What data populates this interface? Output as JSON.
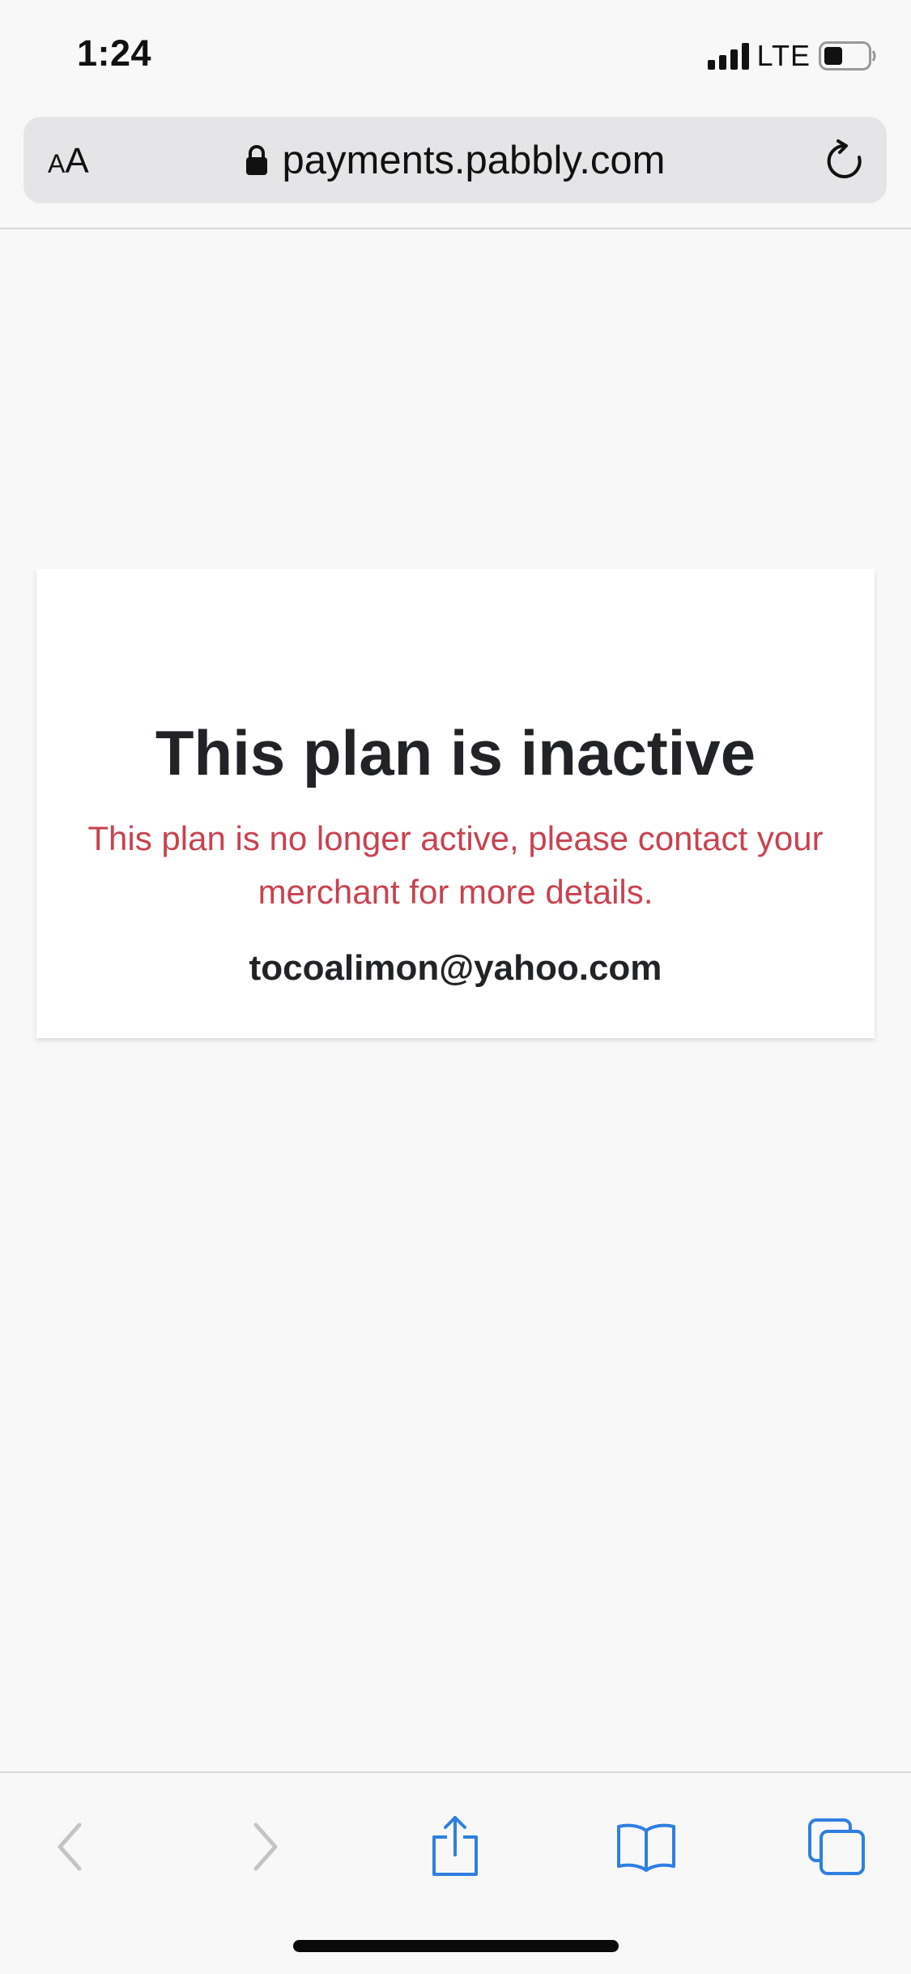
{
  "status_bar": {
    "time": "1:24",
    "network": "LTE",
    "signal_icon": "signal-bars-icon",
    "battery_icon": "battery-icon"
  },
  "browser": {
    "text_size_button": {
      "small": "A",
      "large": "A"
    },
    "lock_icon": "lock-icon",
    "url": "payments.pabbly.com",
    "reload_icon": "reload-icon"
  },
  "card": {
    "title": "This plan is inactive",
    "message": "This plan is no longer active, please contact your merchant for more details.",
    "email": "tocoalimon@yahoo.com"
  },
  "toolbar": {
    "items": [
      {
        "icon": "back-chevron-icon",
        "enabled": false
      },
      {
        "icon": "forward-chevron-icon",
        "enabled": false
      },
      {
        "icon": "share-icon",
        "enabled": true
      },
      {
        "icon": "bookmarks-icon",
        "enabled": true
      },
      {
        "icon": "tabs-icon",
        "enabled": true
      }
    ]
  },
  "colors": {
    "accent": "#2f7fe0",
    "error_text": "#c9424f",
    "disabled": "#c4c4c8",
    "page_bg": "#f8f8f9",
    "card_bg": "#ffffff",
    "url_bar_bg": "#e5e5e7"
  }
}
